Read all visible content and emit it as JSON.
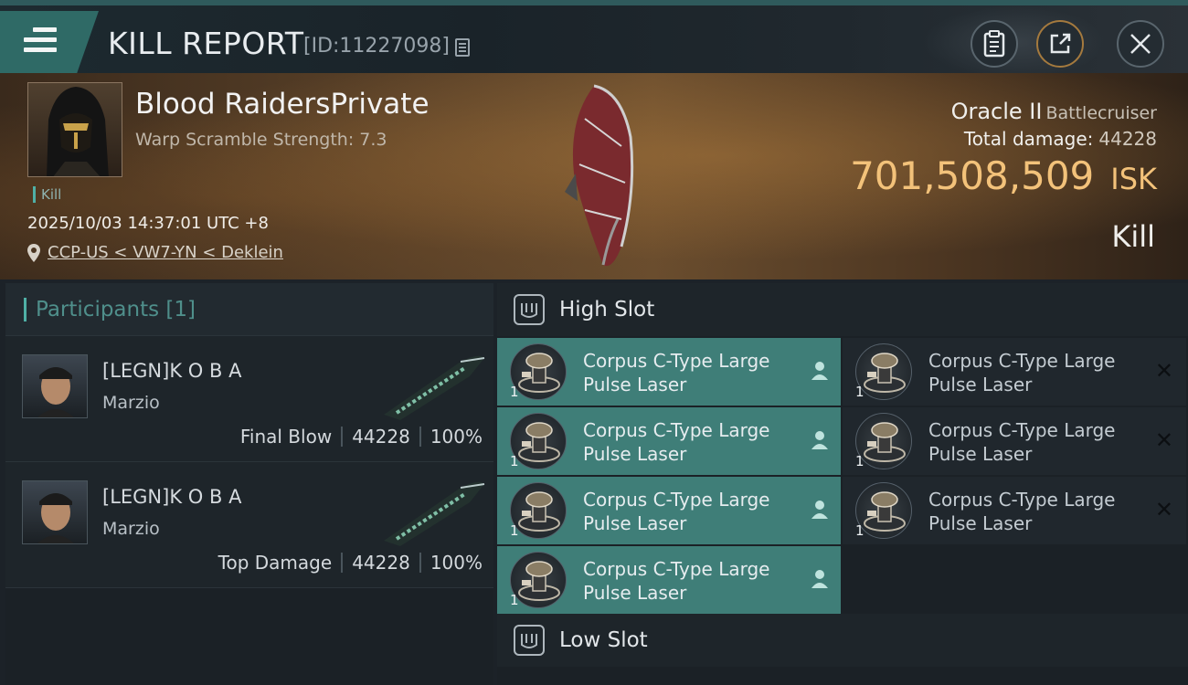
{
  "header": {
    "title": "KILL REPORT",
    "report_id": "[ID:11227098]"
  },
  "victim": {
    "pilot_name": "Blood RaidersPrivate",
    "warp_scramble": "Warp Scramble Strength: 7.3",
    "tag": "Kill",
    "datetime": "2025/10/03 14:37:01 UTC +8",
    "location": "CCP-US < VW7-YN < Deklein",
    "ship_name": "Oracle II",
    "ship_class": "Battlecruiser",
    "total_damage_label": "Total damage:",
    "total_damage_value": "44228",
    "isk_value": "701,508,509",
    "isk_unit": "ISK",
    "result": "Kill"
  },
  "participants": {
    "heading": "Participants",
    "count": "[1]",
    "rows": [
      {
        "corp_name": "[LEGN]K O B A",
        "pilot": "Marzio",
        "role": "Final Blow",
        "damage": "44228",
        "percent": "100%"
      },
      {
        "corp_name": "[LEGN]K O B A",
        "pilot": "Marzio",
        "role": "Top Damage",
        "damage": "44228",
        "percent": "100%"
      }
    ]
  },
  "fitting": {
    "high_slot_label": "High Slot",
    "low_slot_label": "Low Slot",
    "high_modules": [
      {
        "name_line1": "Corpus C-Type Large",
        "name_line2": "Pulse Laser",
        "qty": "1",
        "state": "fitted"
      },
      {
        "name_line1": "Corpus C-Type Large",
        "name_line2": "Pulse Laser",
        "qty": "1",
        "state": "destroyed"
      },
      {
        "name_line1": "Corpus C-Type Large",
        "name_line2": "Pulse Laser",
        "qty": "1",
        "state": "fitted"
      },
      {
        "name_line1": "Corpus C-Type Large",
        "name_line2": "Pulse Laser",
        "qty": "1",
        "state": "destroyed"
      },
      {
        "name_line1": "Corpus C-Type Large",
        "name_line2": "Pulse Laser",
        "qty": "1",
        "state": "fitted"
      },
      {
        "name_line1": "Corpus C-Type Large",
        "name_line2": "Pulse Laser",
        "qty": "1",
        "state": "destroyed"
      },
      {
        "name_line1": "Corpus C-Type Large",
        "name_line2": "Pulse Laser",
        "qty": "1",
        "state": "fitted"
      }
    ]
  },
  "colors": {
    "accent": "#4fb0a6",
    "fitted_module": "#3f7e78",
    "isk": "#f3c27a"
  },
  "icons": [
    "menu-icon",
    "copy-icon",
    "clipboard-icon",
    "share-icon",
    "close-icon",
    "location-pin-icon",
    "slot-icon",
    "person-icon",
    "x-icon"
  ]
}
